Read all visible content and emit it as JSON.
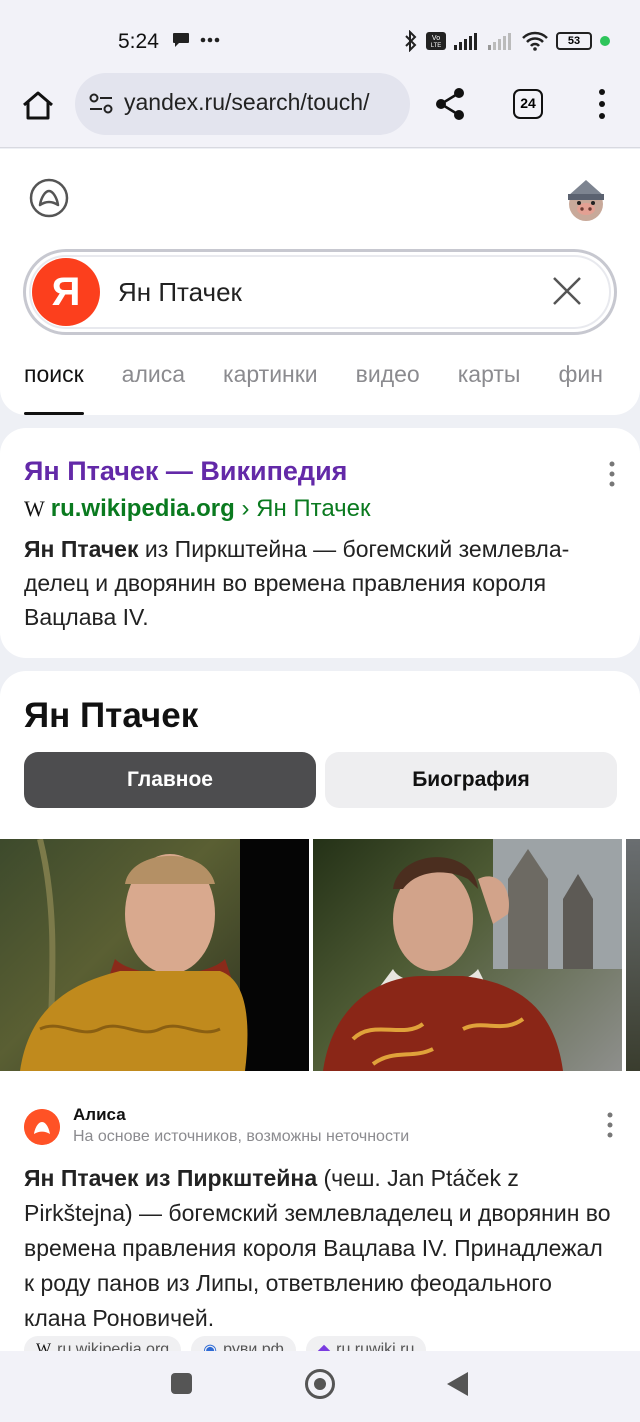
{
  "status_bar": {
    "time": "5:24",
    "battery": "53",
    "icons": [
      "chat-bubble-icon",
      "more-dots-icon",
      "bluetooth-icon",
      "volte-icon",
      "signal-icon",
      "signal-weak-icon",
      "wifi-icon",
      "battery-icon"
    ]
  },
  "browser": {
    "url": "yandex.ru/search/touch/",
    "tab_count": "24"
  },
  "search": {
    "logo": "Я",
    "query": "Ян Птачек",
    "tabs": [
      {
        "label": "поиск",
        "active": true
      },
      {
        "label": "алиса",
        "active": false
      },
      {
        "label": "картинки",
        "active": false
      },
      {
        "label": "видео",
        "active": false
      },
      {
        "label": "карты",
        "active": false
      },
      {
        "label": "фин",
        "active": false
      }
    ]
  },
  "wiki_result": {
    "title": "Ян Птачек — Википедия",
    "domain_icon": "W",
    "domain": "ru.wikipedia.org",
    "path": " › Ян Птачек",
    "snippet_bold": "Ян Птачек",
    "snippet_rest": " из Пиркштейна — богемский землевла­делец и дворянин во времена правления короля Вацлава IV."
  },
  "entity": {
    "title": "Ян Птачек",
    "tab_main": "Главное",
    "tab_bio": "Биография"
  },
  "alice": {
    "name": "Алиса",
    "subtitle": "На основе источников, возможны неточности",
    "text_bold": "Ян Птачек из Пиркштейна",
    "text_rest": " (чеш. Jan Ptáček z Pirkštejna) — богемский землевладелец и дворянин во времена правления короля Вацлава IV. Принадлежал к роду панов из Липы, ответвлению феодального клана Роновичей.",
    "sources": [
      "ru.wikipedia.org",
      "руви.рф",
      "ru.ruwiki.ru"
    ]
  },
  "colors": {
    "yandex_red": "#fc3f1d",
    "link_purple": "#6329a8",
    "url_green": "#0a7a1f"
  }
}
